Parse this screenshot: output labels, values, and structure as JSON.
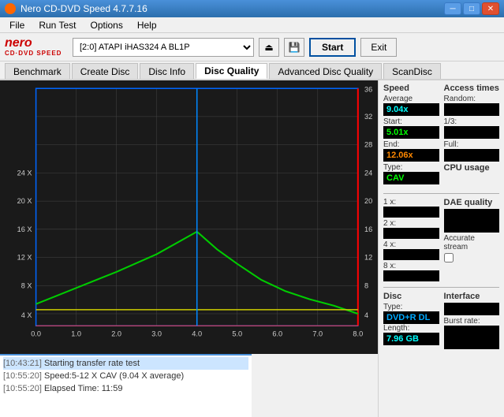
{
  "titleBar": {
    "title": "Nero CD-DVD Speed 4.7.7.16",
    "minimize": "─",
    "restore": "□",
    "close": "✕"
  },
  "menu": {
    "items": [
      "File",
      "Run Test",
      "Options",
      "Help"
    ]
  },
  "toolbar": {
    "logoTop": "nero",
    "logoBottom": "CD·DVD SPEED",
    "driveValue": "[2:0]  ATAPI iHAS324  A BL1P",
    "startLabel": "Start",
    "exitLabel": "Exit"
  },
  "tabs": [
    {
      "label": "Benchmark",
      "active": false
    },
    {
      "label": "Create Disc",
      "active": false
    },
    {
      "label": "Disc Info",
      "active": false
    },
    {
      "label": "Disc Quality",
      "active": true
    },
    {
      "label": "Advanced Disc Quality",
      "active": false
    },
    {
      "label": "ScanDisc",
      "active": false
    }
  ],
  "chart": {
    "xLabels": [
      "0.0",
      "1.0",
      "2.0",
      "3.0",
      "4.0",
      "5.0",
      "6.0",
      "7.0",
      "8.0"
    ],
    "yLeftLabels": [
      "4 X",
      "8 X",
      "12 X",
      "16 X",
      "20 X",
      "24 X"
    ],
    "yRightLabels": [
      "4",
      "8",
      "12",
      "16",
      "20",
      "24",
      "28",
      "32",
      "36"
    ]
  },
  "rightPanel": {
    "speed": {
      "header": "Speed",
      "avgLabel": "Average",
      "avgValue": "9.04x",
      "startLabel": "Start:",
      "startValue": "5.01x",
      "endLabel": "End:",
      "endValue": "12.06x",
      "typeLabel": "Type:",
      "typeValue": "CAV"
    },
    "accessTimes": {
      "header": "Access times",
      "randomLabel": "Random:",
      "randomValue": "",
      "oneThirdLabel": "1/3:",
      "oneThirdValue": "",
      "fullLabel": "Full:",
      "fullValue": ""
    },
    "cpuUsage": {
      "header": "CPU usage",
      "oneXLabel": "1 x:",
      "oneXValue": "",
      "twoXLabel": "2 x:",
      "twoXValue": "",
      "fourXLabel": "4 x:",
      "fourXValue": "",
      "eightXLabel": "8 x:",
      "eightXValue": ""
    },
    "dae": {
      "header": "DAE quality",
      "value": "",
      "accurateLabel": "Accurate",
      "streamLabel": "stream"
    },
    "disc": {
      "header": "Disc",
      "typeLabel": "Type:",
      "typeValue": "DVD+R DL",
      "lengthLabel": "Length:",
      "lengthValue": "7.96 GB",
      "interfaceHeader": "Interface",
      "burstRateLabel": "Burst rate:"
    }
  },
  "log": {
    "entries": [
      {
        "timestamp": "[10:43:21]",
        "text": "Starting transfer rate test"
      },
      {
        "timestamp": "[10:55:20]",
        "text": "Speed:5-12 X CAV (9.04 X average)"
      },
      {
        "timestamp": "[10:55:20]",
        "text": "Elapsed Time: 11:59"
      }
    ]
  }
}
